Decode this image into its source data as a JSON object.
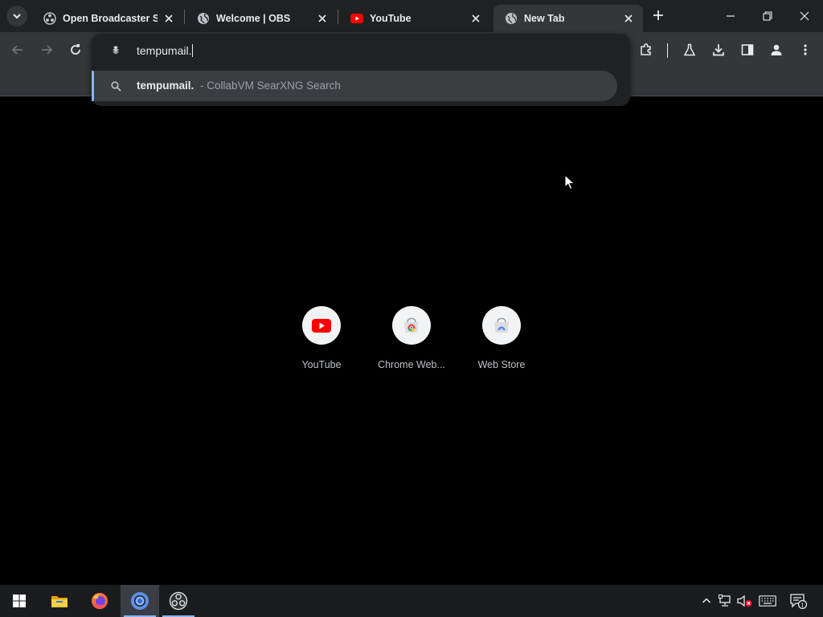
{
  "tabs": [
    {
      "title": "Open Broadcaster Sof",
      "icon": "obs-icon",
      "active": false
    },
    {
      "title": "Welcome | OBS",
      "icon": "globe-icon",
      "active": false
    },
    {
      "title": "YouTube",
      "icon": "youtube-icon",
      "active": false
    },
    {
      "title": "New Tab",
      "icon": "globe-icon",
      "active": true
    }
  ],
  "omnibox": {
    "input_value": "tempumail.",
    "suggestions": [
      {
        "main": "tempumail.",
        "separator": "-",
        "description": "CollabVM SearXNG Search",
        "icon": "search-icon"
      }
    ]
  },
  "shortcuts": [
    {
      "label": "YouTube",
      "icon": "youtube-icon"
    },
    {
      "label": "Chrome Web...",
      "icon": "chrome-web-store-icon"
    },
    {
      "label": "Web Store",
      "icon": "web-store-icon"
    }
  ],
  "taskbar": {
    "items": [
      "start-icon",
      "file-explorer-icon",
      "firefox-icon",
      "chrome-icon",
      "obs-icon"
    ],
    "notification_count": "1"
  },
  "colors": {
    "accent": "#8ab4f8",
    "youtube_red": "#ff0000",
    "tab_strip": "#202124",
    "toolbar": "#35363a"
  }
}
